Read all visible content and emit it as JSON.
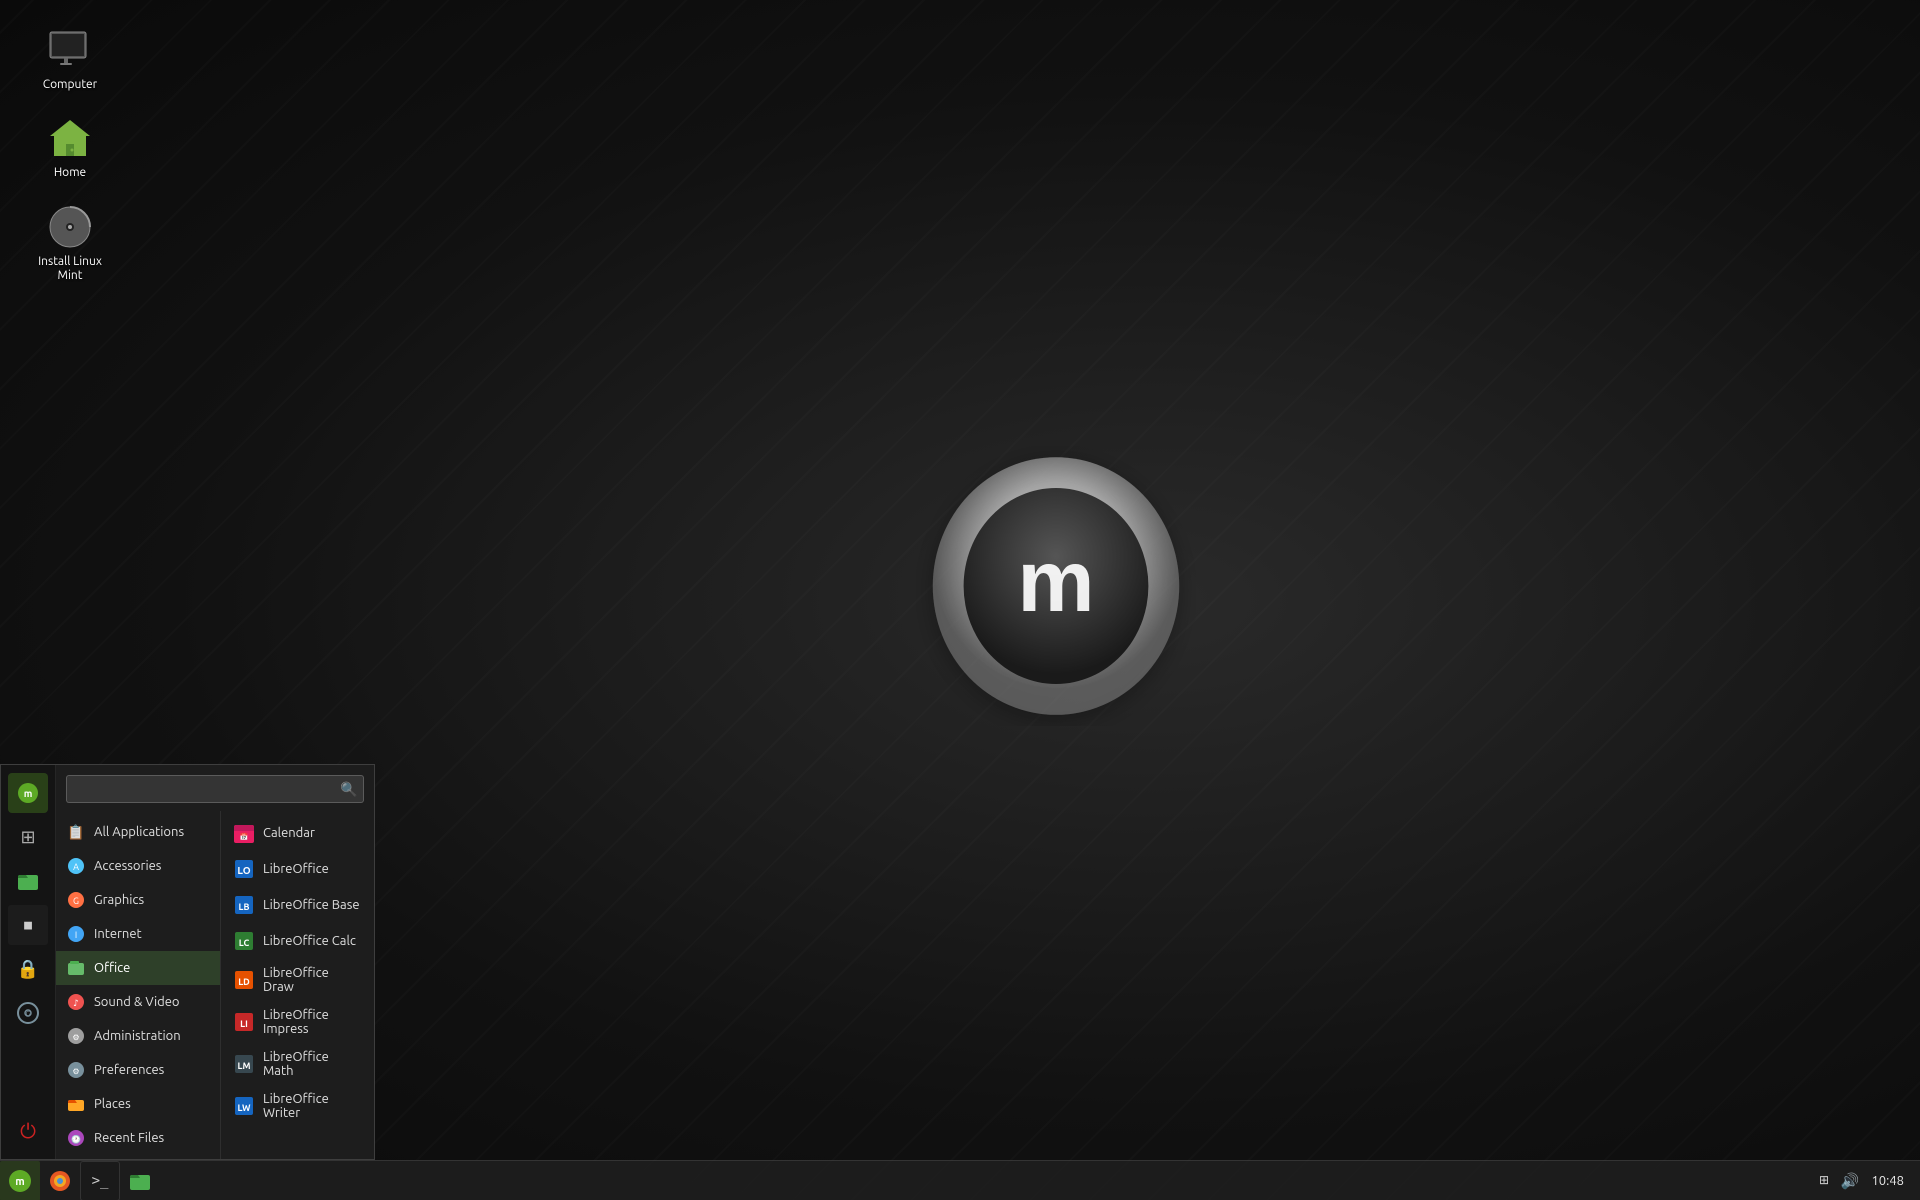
{
  "desktop": {
    "icons": [
      {
        "id": "computer",
        "label": "Computer",
        "type": "computer"
      },
      {
        "id": "home",
        "label": "Home",
        "type": "home"
      },
      {
        "id": "install",
        "label": "Install Linux Mint",
        "type": "disc"
      }
    ]
  },
  "start_menu": {
    "search_placeholder": "",
    "categories": [
      {
        "id": "all",
        "label": "All Applications",
        "icon": "📋"
      },
      {
        "id": "accessories",
        "label": "Accessories",
        "icon": "🔧",
        "color": "accessories"
      },
      {
        "id": "graphics",
        "label": "Graphics",
        "icon": "🎨",
        "color": "graphics"
      },
      {
        "id": "internet",
        "label": "Internet",
        "icon": "🌐",
        "color": "internet"
      },
      {
        "id": "office",
        "label": "Office",
        "icon": "📁",
        "color": "office",
        "active": true
      },
      {
        "id": "sound",
        "label": "Sound & Video",
        "icon": "🎵",
        "color": "sound"
      },
      {
        "id": "administration",
        "label": "Administration",
        "icon": "⚙",
        "color": "admin"
      },
      {
        "id": "preferences",
        "label": "Preferences",
        "icon": "⚙",
        "color": "prefs"
      },
      {
        "id": "places",
        "label": "Places",
        "icon": "📁",
        "color": "places"
      },
      {
        "id": "recent",
        "label": "Recent Files",
        "icon": "🕐",
        "color": "recent"
      }
    ],
    "apps": [
      {
        "id": "calendar",
        "label": "Calendar",
        "icon": "📅",
        "color": "#e91e63"
      },
      {
        "id": "libreoffice",
        "label": "LibreOffice",
        "icon": "LO",
        "color": "#1565c0"
      },
      {
        "id": "lo-base",
        "label": "LibreOffice Base",
        "icon": "LB",
        "color": "#1565c0"
      },
      {
        "id": "lo-calc",
        "label": "LibreOffice Calc",
        "icon": "LC",
        "color": "#2e7d32"
      },
      {
        "id": "lo-draw",
        "label": "LibreOffice Draw",
        "icon": "LD",
        "color": "#e65100"
      },
      {
        "id": "lo-impress",
        "label": "LibreOffice Impress",
        "icon": "LI",
        "color": "#c62828"
      },
      {
        "id": "lo-math",
        "label": "LibreOffice Math",
        "icon": "LM",
        "color": "#37474f"
      },
      {
        "id": "lo-writer",
        "label": "LibreOffice Writer",
        "icon": "LW",
        "color": "#1565c0"
      }
    ],
    "sidebar_icons": [
      {
        "id": "mint-menu",
        "label": "Mint Menu",
        "icon": "🍃",
        "color": "#5daa25"
      },
      {
        "id": "show-desktop",
        "label": "Show Desktop",
        "icon": "⊞",
        "color": "#aaa"
      },
      {
        "id": "nemo",
        "label": "Files",
        "icon": "📁",
        "color": "#77a"
      },
      {
        "id": "terminal",
        "label": "Terminal",
        "icon": ">_",
        "color": "#333"
      },
      {
        "id": "lock",
        "label": "Lock Screen",
        "icon": "🔒",
        "color": "#555"
      },
      {
        "id": "browser",
        "label": "Web Browser",
        "icon": "⊙",
        "color": "#777"
      },
      {
        "id": "shutdown",
        "label": "Shutdown",
        "icon": "⏻",
        "color": "#c00"
      }
    ]
  },
  "taskbar": {
    "left_icons": [
      {
        "id": "mintmenu",
        "label": "Menu",
        "type": "mint"
      },
      {
        "id": "firefox",
        "label": "Firefox",
        "type": "firefox"
      },
      {
        "id": "terminal",
        "label": "Terminal",
        "type": "terminal"
      },
      {
        "id": "files",
        "label": "Files",
        "type": "folder"
      }
    ],
    "time": "10:48",
    "tray_icons": [
      "network",
      "volume"
    ]
  }
}
